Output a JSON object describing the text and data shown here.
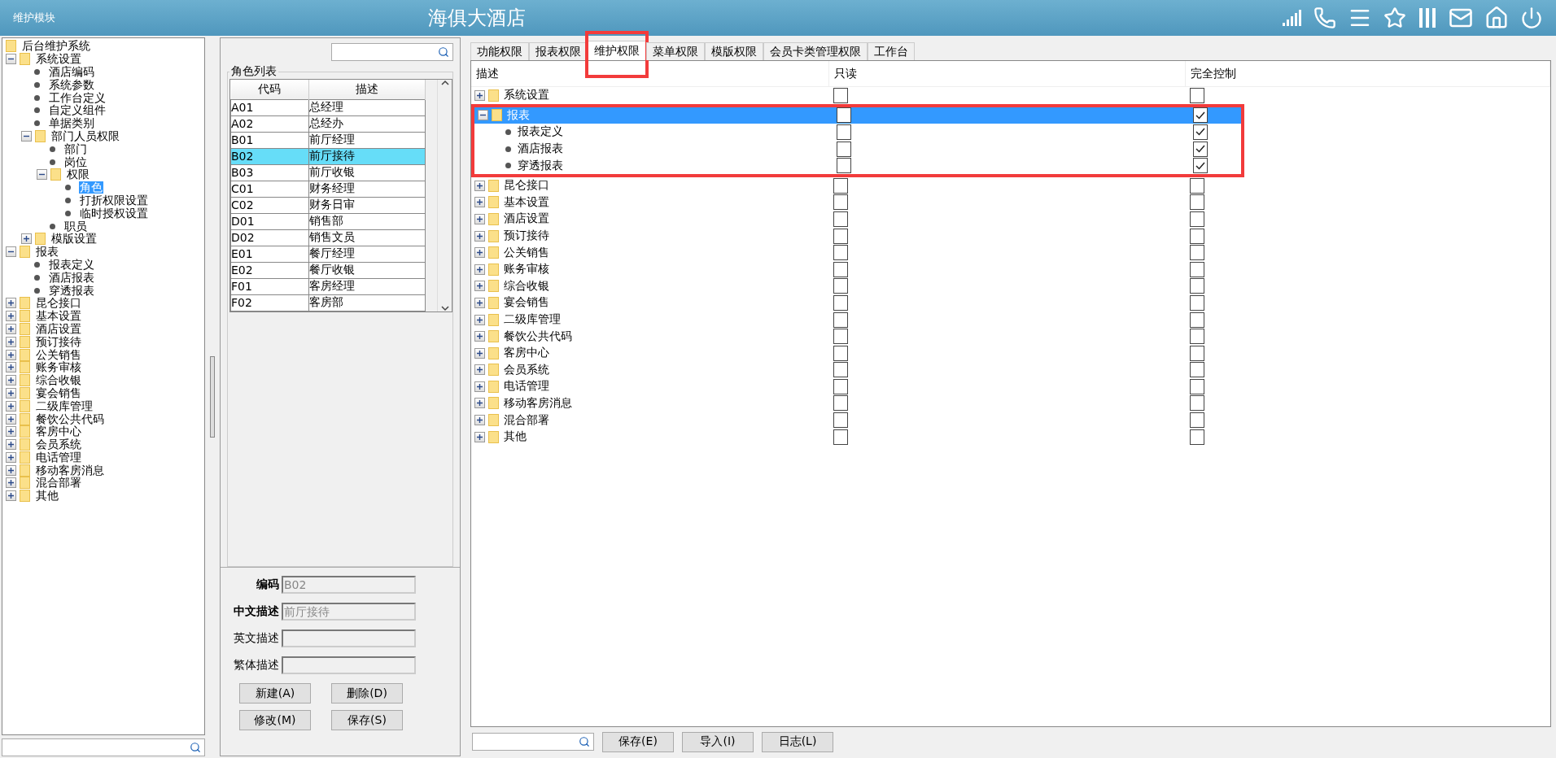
{
  "header": {
    "module": "维护模块",
    "title": "海俱大酒店"
  },
  "nav_tree": [
    {
      "label": "后台维护系统",
      "kind": "folder",
      "selected": false
    },
    {
      "label": "系统设置",
      "kind": "folder",
      "expanded": true,
      "selected": false,
      "children": [
        {
          "label": "酒店编码",
          "kind": "leaf",
          "selected": false
        },
        {
          "label": "系统参数",
          "kind": "leaf",
          "selected": false
        },
        {
          "label": "工作台定义",
          "kind": "leaf",
          "selected": false
        },
        {
          "label": "自定义组件",
          "kind": "leaf",
          "selected": false
        },
        {
          "label": "单据类别",
          "kind": "leaf",
          "selected": false
        },
        {
          "label": "部门人员权限",
          "kind": "folder",
          "expanded": true,
          "selected": false,
          "children": [
            {
              "label": "部门",
              "kind": "leaf",
              "selected": false
            },
            {
              "label": "岗位",
              "kind": "leaf",
              "selected": false
            },
            {
              "label": "权限",
              "kind": "folder",
              "expanded": true,
              "selected": false,
              "children": [
                {
                  "label": "角色",
                  "kind": "leaf",
                  "selected": true
                },
                {
                  "label": "打折权限设置",
                  "kind": "leaf",
                  "selected": false
                },
                {
                  "label": "临时授权设置",
                  "kind": "leaf",
                  "selected": false
                }
              ]
            },
            {
              "label": "职员",
              "kind": "leaf",
              "selected": false
            }
          ]
        },
        {
          "label": "模版设置",
          "kind": "folder",
          "expanded": false,
          "selected": false
        }
      ]
    },
    {
      "label": "报表",
      "kind": "folder",
      "expanded": true,
      "selected": false,
      "children": [
        {
          "label": "报表定义",
          "kind": "leaf",
          "selected": false
        },
        {
          "label": "酒店报表",
          "kind": "leaf",
          "selected": false
        },
        {
          "label": "穿透报表",
          "kind": "leaf",
          "selected": false
        }
      ]
    },
    {
      "label": "昆仑接口",
      "kind": "folder",
      "expanded": false,
      "selected": false
    },
    {
      "label": "基本设置",
      "kind": "folder",
      "expanded": false,
      "selected": false
    },
    {
      "label": "酒店设置",
      "kind": "folder",
      "expanded": false,
      "selected": false
    },
    {
      "label": "预订接待",
      "kind": "folder",
      "expanded": false,
      "selected": false
    },
    {
      "label": "公关销售",
      "kind": "folder",
      "expanded": false,
      "selected": false
    },
    {
      "label": "账务审核",
      "kind": "folder",
      "expanded": false,
      "selected": false
    },
    {
      "label": "综合收银",
      "kind": "folder",
      "expanded": false,
      "selected": false
    },
    {
      "label": "宴会销售",
      "kind": "folder",
      "expanded": false,
      "selected": false
    },
    {
      "label": "二级库管理",
      "kind": "folder",
      "expanded": false,
      "selected": false
    },
    {
      "label": "餐饮公共代码",
      "kind": "folder",
      "expanded": false,
      "selected": false
    },
    {
      "label": "客房中心",
      "kind": "folder",
      "expanded": false,
      "selected": false
    },
    {
      "label": "会员系统",
      "kind": "folder",
      "expanded": false,
      "selected": false
    },
    {
      "label": "电话管理",
      "kind": "folder",
      "expanded": false,
      "selected": false
    },
    {
      "label": "移动客房消息",
      "kind": "folder",
      "expanded": false,
      "selected": false
    },
    {
      "label": "混合部署",
      "kind": "folder",
      "expanded": false,
      "selected": false
    },
    {
      "label": "其他",
      "kind": "folder",
      "expanded": false,
      "selected": false
    }
  ],
  "role_list": {
    "title": "角色列表",
    "columns": [
      "代码",
      "描述"
    ],
    "rows": [
      {
        "code": "A01",
        "desc": "总经理",
        "selected": false
      },
      {
        "code": "A02",
        "desc": "总经办",
        "selected": false
      },
      {
        "code": "B01",
        "desc": "前厅经理",
        "selected": false
      },
      {
        "code": "B02",
        "desc": "前厅接待",
        "selected": true
      },
      {
        "code": "B03",
        "desc": "前厅收银",
        "selected": false
      },
      {
        "code": "C01",
        "desc": "财务经理",
        "selected": false
      },
      {
        "code": "C02",
        "desc": "财务日审",
        "selected": false
      },
      {
        "code": "D01",
        "desc": "销售部",
        "selected": false
      },
      {
        "code": "D02",
        "desc": "销售文员",
        "selected": false
      },
      {
        "code": "E01",
        "desc": "餐厅经理",
        "selected": false
      },
      {
        "code": "E02",
        "desc": "餐厅收银",
        "selected": false
      },
      {
        "code": "F01",
        "desc": "客房经理",
        "selected": false
      },
      {
        "code": "F02",
        "desc": "客房部",
        "selected": false
      }
    ]
  },
  "role_form": {
    "fields": [
      {
        "label": "编码",
        "value": "B02",
        "required": true
      },
      {
        "label": "中文描述",
        "value": "前厅接待",
        "required": true
      },
      {
        "label": "英文描述",
        "required": false
      },
      {
        "label": "繁体描述",
        "required": false
      }
    ],
    "buttons": [
      "新建(A)",
      "删除(D)",
      "修改(M)",
      "保存(S)"
    ]
  },
  "tabs": [
    {
      "label": "功能权限",
      "selected": false
    },
    {
      "label": "报表权限",
      "selected": false
    },
    {
      "label": "维护权限",
      "selected": true
    },
    {
      "label": "菜单权限",
      "selected": false
    },
    {
      "label": "模版权限",
      "selected": false
    },
    {
      "label": "会员卡类管理权限",
      "selected": false
    },
    {
      "label": "工作台",
      "selected": false
    }
  ],
  "permissions": {
    "columns": [
      "描述",
      "只读",
      "完全控制"
    ],
    "rows": [
      {
        "label": "系统设置",
        "kind": "folder",
        "expanded": false,
        "selected": false,
        "read_only": false,
        "full_control": false
      },
      {
        "label": "报表",
        "kind": "folder",
        "expanded": true,
        "selected": true,
        "read_only": false,
        "full_control": true,
        "children": [
          {
            "label": "报表定义",
            "kind": "leaf",
            "selected": false,
            "read_only": false,
            "full_control": true
          },
          {
            "label": "酒店报表",
            "kind": "leaf",
            "selected": false,
            "read_only": false,
            "full_control": true
          },
          {
            "label": "穿透报表",
            "kind": "leaf",
            "selected": false,
            "read_only": false,
            "full_control": true
          }
        ]
      },
      {
        "label": "昆仑接口",
        "kind": "folder",
        "expanded": false,
        "selected": false,
        "read_only": false,
        "full_control": false
      },
      {
        "label": "基本设置",
        "kind": "folder",
        "expanded": false,
        "selected": false,
        "read_only": false,
        "full_control": false
      },
      {
        "label": "酒店设置",
        "kind": "folder",
        "expanded": false,
        "selected": false,
        "read_only": false,
        "full_control": false
      },
      {
        "label": "预订接待",
        "kind": "folder",
        "expanded": false,
        "selected": false,
        "read_only": false,
        "full_control": false
      },
      {
        "label": "公关销售",
        "kind": "folder",
        "expanded": false,
        "selected": false,
        "read_only": false,
        "full_control": false
      },
      {
        "label": "账务审核",
        "kind": "folder",
        "expanded": false,
        "selected": false,
        "read_only": false,
        "full_control": false
      },
      {
        "label": "综合收银",
        "kind": "folder",
        "expanded": false,
        "selected": false,
        "read_only": false,
        "full_control": false
      },
      {
        "label": "宴会销售",
        "kind": "folder",
        "expanded": false,
        "selected": false,
        "read_only": false,
        "full_control": false
      },
      {
        "label": "二级库管理",
        "kind": "folder",
        "expanded": false,
        "selected": false,
        "read_only": false,
        "full_control": false
      },
      {
        "label": "餐饮公共代码",
        "kind": "folder",
        "expanded": false,
        "selected": false,
        "read_only": false,
        "full_control": false
      },
      {
        "label": "客房中心",
        "kind": "folder",
        "expanded": false,
        "selected": false,
        "read_only": false,
        "full_control": false
      },
      {
        "label": "会员系统",
        "kind": "folder",
        "expanded": false,
        "selected": false,
        "read_only": false,
        "full_control": false
      },
      {
        "label": "电话管理",
        "kind": "folder",
        "expanded": false,
        "selected": false,
        "read_only": false,
        "full_control": false
      },
      {
        "label": "移动客房消息",
        "kind": "folder",
        "expanded": false,
        "selected": false,
        "read_only": false,
        "full_control": false
      },
      {
        "label": "混合部署",
        "kind": "folder",
        "expanded": false,
        "selected": false,
        "read_only": false,
        "full_control": false
      },
      {
        "label": "其他",
        "kind": "folder",
        "expanded": false,
        "selected": false,
        "read_only": false,
        "full_control": false
      }
    ]
  },
  "bottom_buttons": [
    "保存(E)",
    "导入(I)",
    "日志(L)"
  ]
}
